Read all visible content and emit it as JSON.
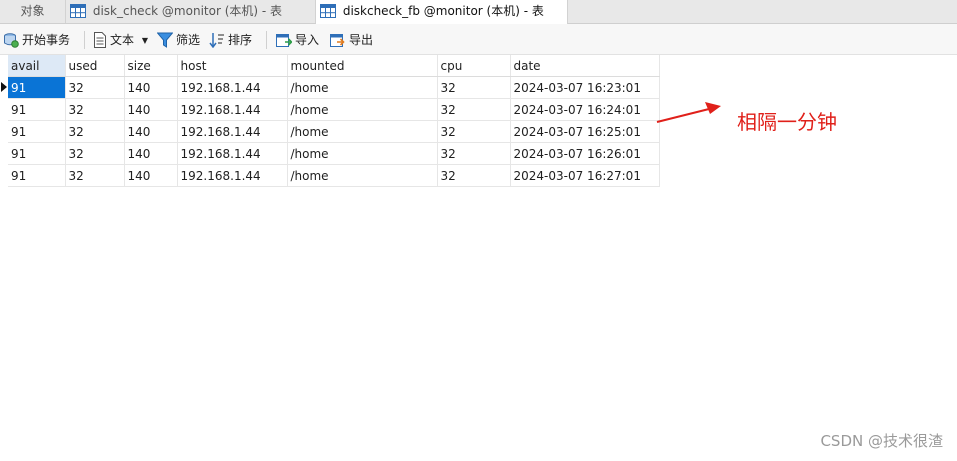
{
  "tabs": [
    {
      "label": "对象",
      "active": false
    },
    {
      "label": "disk_check @monitor (本机) - 表",
      "active": false
    },
    {
      "label": "diskcheck_fb @monitor (本机) - 表",
      "active": true
    }
  ],
  "toolbar": {
    "begin_transaction": "开始事务",
    "text": "文本",
    "filter": "筛选",
    "sort": "排序",
    "import": "导入",
    "export": "导出"
  },
  "table": {
    "columns": [
      "avail",
      "used",
      "size",
      "host",
      "mounted",
      "cpu",
      "date"
    ],
    "rows": [
      [
        "91",
        "32",
        "140",
        "192.168.1.44",
        "/home",
        "32",
        "2024-03-07 16:23:01"
      ],
      [
        "91",
        "32",
        "140",
        "192.168.1.44",
        "/home",
        "32",
        "2024-03-07 16:24:01"
      ],
      [
        "91",
        "32",
        "140",
        "192.168.1.44",
        "/home",
        "32",
        "2024-03-07 16:25:01"
      ],
      [
        "91",
        "32",
        "140",
        "192.168.1.44",
        "/home",
        "32",
        "2024-03-07 16:26:01"
      ],
      [
        "91",
        "32",
        "140",
        "192.168.1.44",
        "/home",
        "32",
        "2024-03-07 16:27:01"
      ]
    ],
    "selected_row": 0,
    "selected_col": 0
  },
  "annotation": {
    "text": "相隔一分钟",
    "color": "#e0201a"
  },
  "watermark": "CSDN @技术很渣"
}
